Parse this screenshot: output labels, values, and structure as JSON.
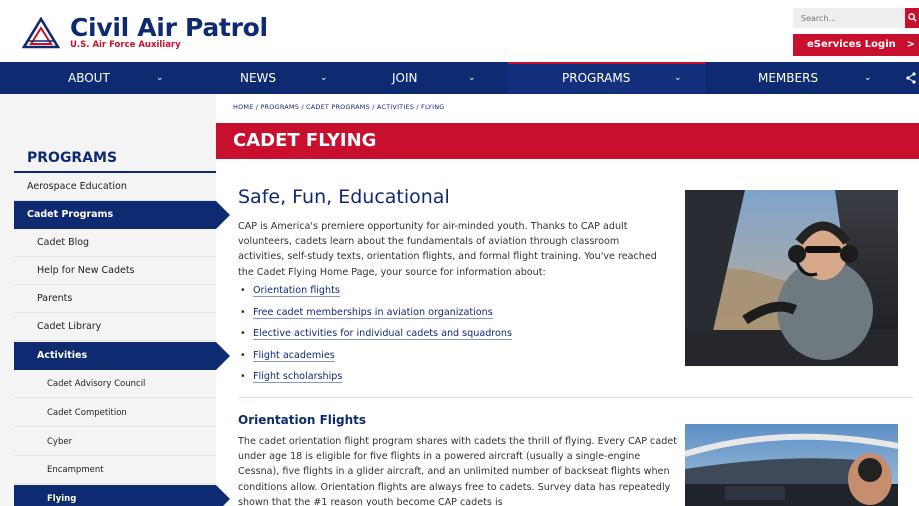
{
  "header": {
    "logo_title": "Civil Air Patrol",
    "logo_subtitle": "U.S. Air Force Auxiliary",
    "search_placeholder": "Search...",
    "eservices_label": "eServices Login",
    "eservices_arrow": ">"
  },
  "nav": {
    "items": [
      {
        "label": "ABOUT"
      },
      {
        "label": "NEWS"
      },
      {
        "label": "JOIN"
      },
      {
        "label": "PROGRAMS",
        "active": true
      },
      {
        "label": "MEMBERS"
      }
    ],
    "chevron": "⌄"
  },
  "breadcrumb": "HOME / PROGRAMS / CADET PROGRAMS / ACTIVITIES / FLYING",
  "page_title": "CADET FLYING",
  "sidebar": {
    "heading": "PROGRAMS",
    "items": [
      {
        "label": "Aerospace Education",
        "level": 1
      },
      {
        "label": "Cadet Programs",
        "level": 1,
        "active": true
      },
      {
        "label": "Cadet Blog",
        "level": 2
      },
      {
        "label": "Help for New Cadets",
        "level": 2
      },
      {
        "label": "Parents",
        "level": 2
      },
      {
        "label": "Cadet Library",
        "level": 2
      },
      {
        "label": "Activities",
        "level": 2,
        "active": true
      },
      {
        "label": "Cadet Advisory Council",
        "level": 3
      },
      {
        "label": "Cadet Competition",
        "level": 3
      },
      {
        "label": "Cyber",
        "level": 3
      },
      {
        "label": "Encampment",
        "level": 3
      },
      {
        "label": "Flying",
        "level": 3,
        "active": true
      }
    ]
  },
  "main": {
    "heading": "Safe, Fun, Educational",
    "intro": "CAP is America's premiere opportunity for air-minded youth. Thanks to CAP adult volunteers, cadets learn about the fundamentals of aviation through classroom activities, self-study texts, orientation flights, and formal flight training. You've reached the Cadet Flying Home Page, your source for information about:",
    "bullets": [
      "Orientation flights",
      "Free cadet memberships in aviation organizations",
      "Elective activities for individual cadets and squadrons",
      "Flight academies",
      "Flight scholarships"
    ],
    "section_heading": "Orientation Flights",
    "section_text": "The cadet orientation flight program shares with cadets the thrill of flying. Every CAP cadet under age 18 is eligible for five flights in a powered aircraft (usually a single-engine Cessna), five flights in a glider aircraft, and an unlimited number of backseat flights when conditions allow. Orientation flights are always free to cadets. Survey data has repeatedly shown that the #1 reason youth become CAP cadets is"
  },
  "colors": {
    "navy": "#0e2b72",
    "red": "#c8102e",
    "sidebar_bg": "#f4f4f4"
  }
}
